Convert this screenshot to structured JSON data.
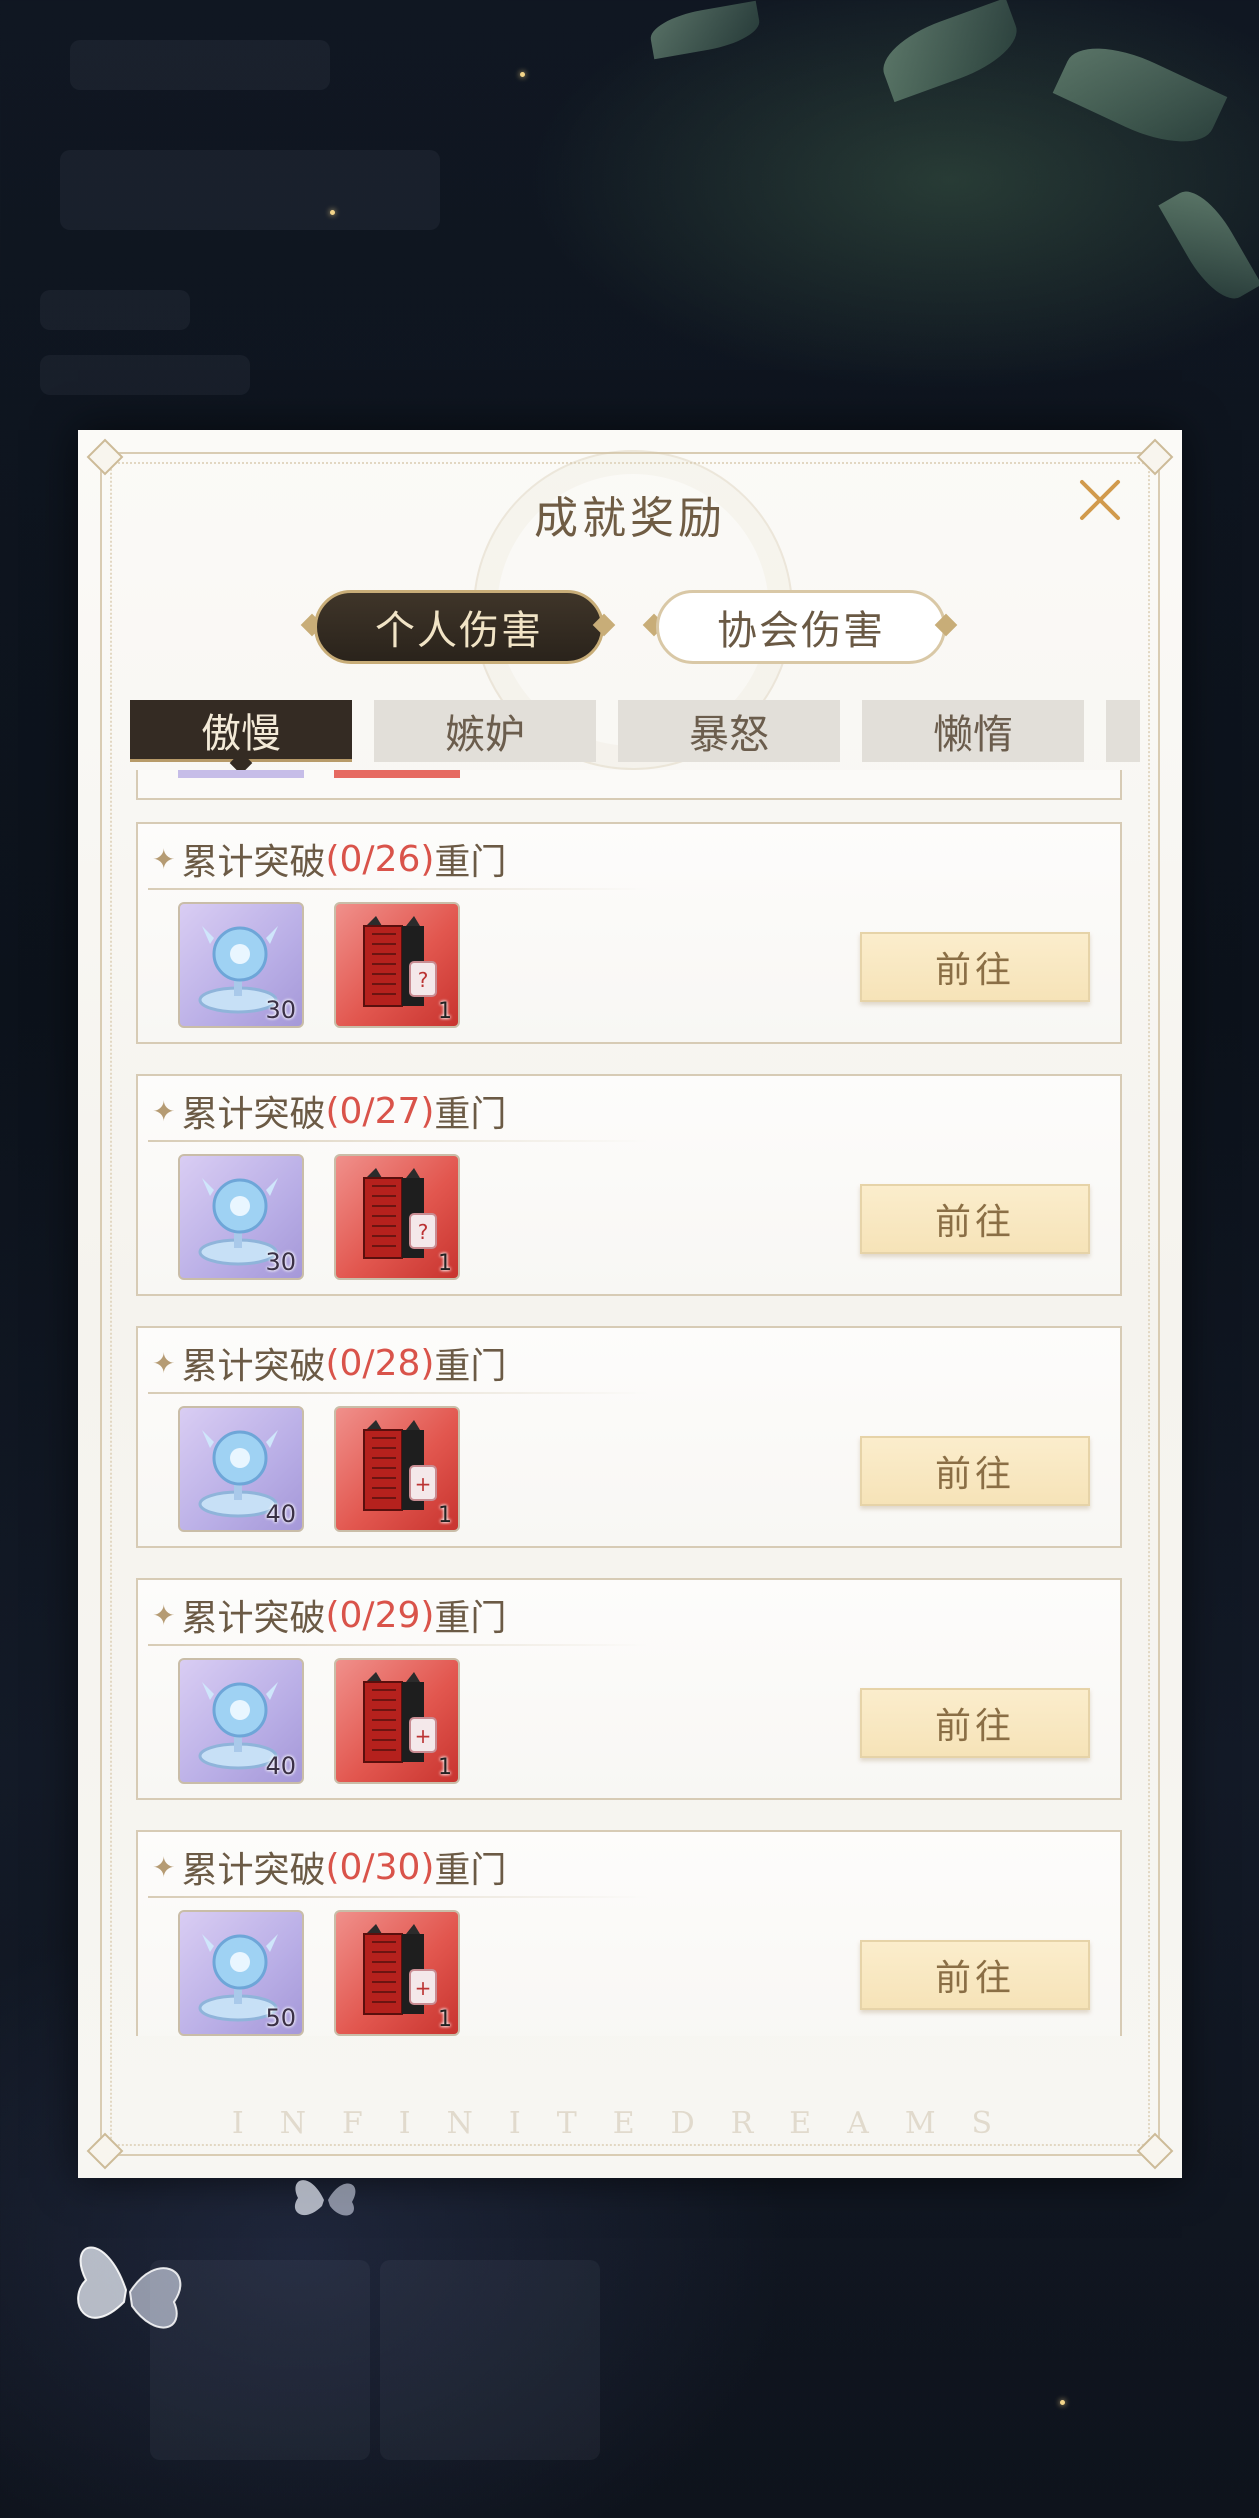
{
  "modal": {
    "title": "成就奖励",
    "main_tabs": [
      {
        "label": "个人伤害",
        "active": true
      },
      {
        "label": "协会伤害",
        "active": false
      }
    ],
    "sub_tabs": [
      {
        "label": "傲慢",
        "active": true
      },
      {
        "label": "嫉妒",
        "active": false
      },
      {
        "label": "暴怒",
        "active": false
      },
      {
        "label": "懒惰",
        "active": false
      }
    ],
    "achievements": [
      {
        "prefix": "累计突破",
        "progress": "(0/26)",
        "suffix": "重门",
        "rewards": [
          {
            "icon": "crystal-icon",
            "qty": "30"
          },
          {
            "icon": "puzzle-box-icon",
            "qty": "1"
          }
        ],
        "button": "前往"
      },
      {
        "prefix": "累计突破",
        "progress": "(0/27)",
        "suffix": "重门",
        "rewards": [
          {
            "icon": "crystal-icon",
            "qty": "30"
          },
          {
            "icon": "puzzle-box-icon",
            "qty": "1"
          }
        ],
        "button": "前往"
      },
      {
        "prefix": "累计突破",
        "progress": "(0/28)",
        "suffix": "重门",
        "rewards": [
          {
            "icon": "crystal-icon",
            "qty": "40"
          },
          {
            "icon": "puzzle-box-icon",
            "qty": "1"
          }
        ],
        "button": "前往"
      },
      {
        "prefix": "累计突破",
        "progress": "(0/29)",
        "suffix": "重门",
        "rewards": [
          {
            "icon": "crystal-icon",
            "qty": "40"
          },
          {
            "icon": "puzzle-box-icon",
            "qty": "1"
          }
        ],
        "button": "前往"
      },
      {
        "prefix": "累计突破",
        "progress": "(0/30)",
        "suffix": "重门",
        "rewards": [
          {
            "icon": "crystal-icon",
            "qty": "50"
          },
          {
            "icon": "puzzle-box-icon",
            "qty": "1"
          }
        ],
        "button": "前往"
      }
    ],
    "footer_watermark": "INFINITEDREAMS"
  },
  "colors": {
    "progress": "#d9534a",
    "active_tab": "#342b23",
    "go_button": "#f6e3b8"
  }
}
